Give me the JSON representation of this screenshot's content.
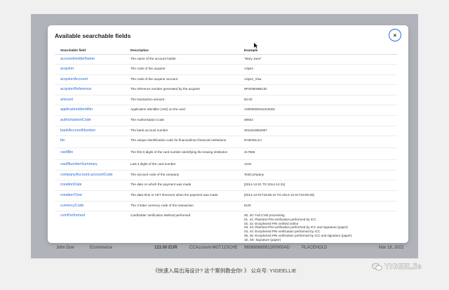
{
  "modal": {
    "title": "Available searchable fields",
    "close_label": "×"
  },
  "table": {
    "headers": [
      "Searchable field",
      "Description",
      "Example"
    ],
    "rows": [
      {
        "field": "accountHolderName",
        "description": "The name of the account holder",
        "example": "\"Mary Jane\""
      },
      {
        "field": "acquirer",
        "description": "The code of the acquirer",
        "example": "Adyen"
      },
      {
        "field": "acquirerAccount",
        "description": "The code of the acquirer account",
        "example": "Adyen_Visa"
      },
      {
        "field": "acquirerReference",
        "description": "The reference number generated by the acquirer",
        "example": "8PON8HBBCID"
      },
      {
        "field": "amount",
        "description": "The transaction amount",
        "example": "50.00"
      },
      {
        "field": "applicationIdentifier",
        "description": "Application Identifier (AID) on the card",
        "example": "A0000000041010002"
      },
      {
        "field": "authorisationCode",
        "description": "The Authorisation Code",
        "example": "59602"
      },
      {
        "field": "bankAccountNumber",
        "description": "The bank account number",
        "example": "2011623852957"
      },
      {
        "field": "bic",
        "description": "The unique identification code for financial/non-financial institutions",
        "example": "RABONL2U"
      },
      {
        "field": "cardBin",
        "description": "The first 6 digits of the card number identifying the issuing institution",
        "example": "417666"
      },
      {
        "field": "cardNumberSummary",
        "description": "Last 4 digits of the card number",
        "example": "1234"
      },
      {
        "field": "companyAccount.accountCode",
        "description": "The account code of the company",
        "example": "TestCompany"
      },
      {
        "field": "creationDate",
        "description": "The date on which the payment was made",
        "example": "[2014-12-01 TO 2014-12-31]"
      },
      {
        "field": "creationTime",
        "description": "The date-time in CET timezone when the payment was made",
        "example": "[2014-12-01T18:55:10 TO 2014-12-01T19:05:30]"
      },
      {
        "field": "currencyCode",
        "description": "The 3 letter currency code of the transaction",
        "example": "EUR"
      },
      {
        "field": "cvmPerformed",
        "description": "Cardholder Verification Method performed",
        "example": "00, 40: Fail CVM processing\n01, 41: Plaintext PIN verification performed by ICC\n02, 42: Enciphered PIN verified online\n03, 43: Plaintext PIN verification performed by ICC and signature (paper)\n04, 44: Enciphered PIN verification performed by ICC\n05, 45: Enciphered PIN verification performed by ICC and signature (paper)\n1E, 5E: Signature (paper)"
      }
    ]
  },
  "background": {
    "row_name": "John Doe",
    "row_type": "Ecommerce",
    "row_amount": "123.00 EUR",
    "row_account": "CCAccount-MGT11SCHE",
    "row_ref": "98088088081200000AD",
    "row_ref2": "PLACEHOLD",
    "row_date": "Mar 18, 2022",
    "row_ref3": "PSPREF01200000000212606"
  },
  "caption": "《快速入局出海设计? 这个案例教会你! 》 公众号: YIGEELLIE",
  "watermark": "YIGEELlie",
  "colors": {
    "link": "#2a6dd6",
    "close_ring": "#2a6dd6",
    "overlay": "#b0b3b9"
  }
}
